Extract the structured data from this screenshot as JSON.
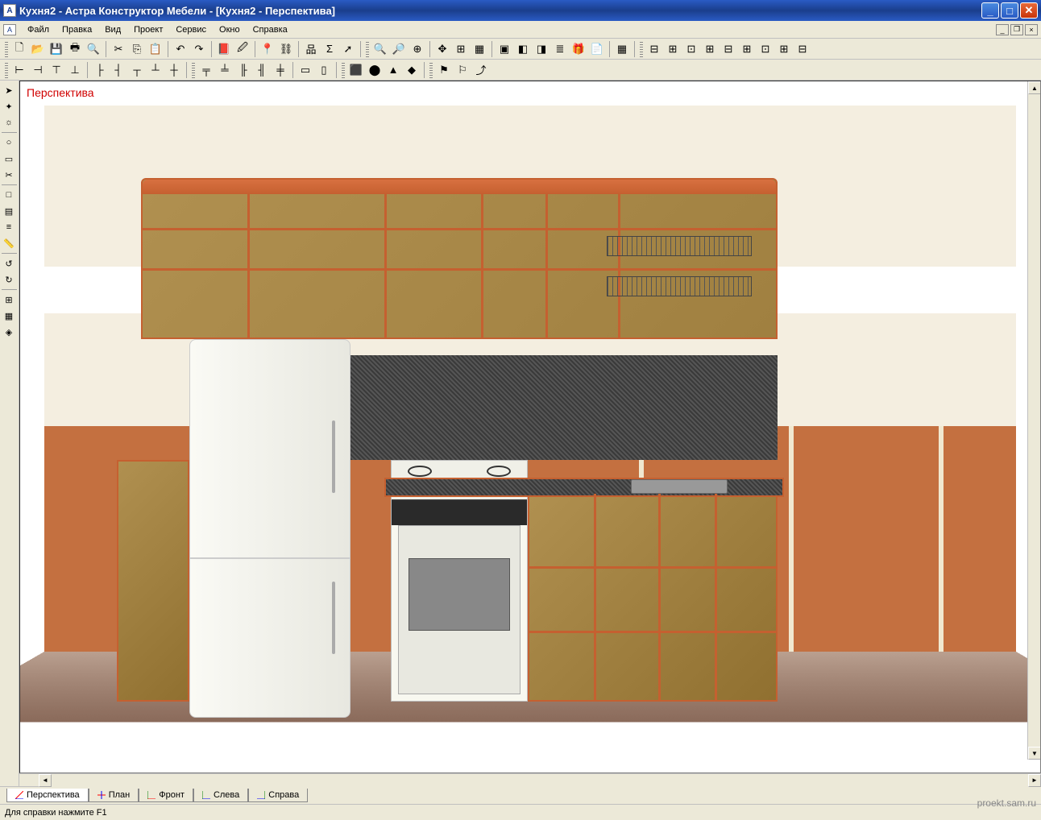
{
  "title": "Кухня2 - Астра Конструктор Мебели - [Кухня2 - Перспектива]",
  "menu": {
    "file": "Файл",
    "edit": "Правка",
    "view": "Вид",
    "project": "Проект",
    "service": "Сервис",
    "window": "Окно",
    "help": "Справка"
  },
  "viewport": {
    "label": "Перспектива"
  },
  "tabs": {
    "perspective": "Перспектива",
    "plan": "План",
    "front": "Фронт",
    "left": "Слева",
    "right": "Справа"
  },
  "status": {
    "help_hint": "Для справки нажмите F1"
  },
  "watermark": "proekt.sam.ru",
  "toolbar1": {
    "new": "new",
    "open": "open",
    "save": "save",
    "print": "print",
    "preview": "preview",
    "cut": "cut",
    "copy": "copy",
    "paste": "paste",
    "undo": "undo",
    "redo": "redo",
    "book": "book",
    "pick": "pick",
    "pin": "pin",
    "link": "link",
    "tree": "tree",
    "sum": "sum",
    "send": "send",
    "zoomin": "zoom-in",
    "zoomout": "zoom-out",
    "zoomfit": "zoom-fit",
    "pan": "pan",
    "center": "center",
    "all": "all",
    "box1": "box1",
    "box2": "box2",
    "box3": "box3",
    "layers": "layers",
    "gift": "gift",
    "note": "note",
    "grid": "grid",
    "l1": "layout1",
    "l2": "layout2",
    "l3": "layout3",
    "l4": "layout4",
    "l5": "layout5",
    "l6": "layout6",
    "l7": "layout7",
    "l8": "layout8",
    "l9": "layout9"
  },
  "toolbar2": {
    "t1": "t1",
    "t2": "t2",
    "t3": "t3",
    "t4": "t4",
    "t5": "t5",
    "t6": "t6",
    "t7": "t7",
    "t8": "t8",
    "t9": "t9",
    "a1": "a1",
    "a2": "a2",
    "a3": "a3",
    "a4": "a4",
    "a5": "a5",
    "b1": "b1",
    "b2": "b2",
    "c1": "c1",
    "c2": "c2",
    "c3": "c3",
    "c4": "c4",
    "c5": "c5",
    "d1": "d1",
    "d2": "d2",
    "d3": "d3"
  },
  "lefttools": {
    "cursor": "cursor",
    "wand": "wand",
    "light": "light",
    "circle": "circle",
    "rect": "rect",
    "scissors": "scissors",
    "sq": "sq",
    "hatch": "hatch",
    "lines": "lines",
    "ruler": "ruler",
    "rot1": "rot1",
    "rot2": "rot2",
    "grid1": "grid1",
    "grid2": "grid2",
    "obj": "obj"
  }
}
